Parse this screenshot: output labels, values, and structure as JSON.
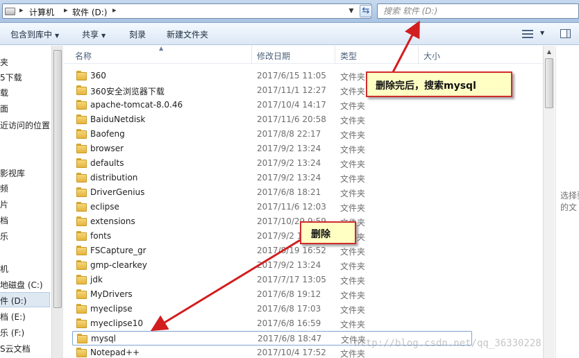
{
  "address_bar": {
    "crumbs": [
      "计算机",
      "软件 (D:)"
    ],
    "search_placeholder": "搜索 软件 (D:)"
  },
  "toolbar": {
    "include_library": "包含到库中",
    "share": "共享",
    "burn": "刻录",
    "new_folder": "新建文件夹"
  },
  "nav": {
    "items": [
      "夹",
      "5下载",
      "载",
      "面",
      "近访问的位置",
      "影视库",
      "频",
      "片",
      "档",
      "乐",
      "机",
      "地磁盘 (C:)",
      "件 (D:)",
      "档 (E:)",
      "乐 (F:)",
      "S云文档"
    ],
    "selected": "件 (D:)"
  },
  "list": {
    "columns": {
      "name": "名称",
      "date": "修改日期",
      "type": "类型",
      "size": "大小"
    },
    "rows": [
      {
        "name": "360",
        "date": "2017/6/15 11:05",
        "type": "文件夹"
      },
      {
        "name": "360安全浏览器下载",
        "date": "2017/11/1 12:27",
        "type": "文件夹"
      },
      {
        "name": "apache-tomcat-8.0.46",
        "date": "2017/10/4 14:17",
        "type": "文件夹"
      },
      {
        "name": "BaiduNetdisk",
        "date": "2017/11/6 20:58",
        "type": "文件夹"
      },
      {
        "name": "Baofeng",
        "date": "2017/8/8 22:17",
        "type": "文件夹"
      },
      {
        "name": "browser",
        "date": "2017/9/2 13:24",
        "type": "文件夹"
      },
      {
        "name": "defaults",
        "date": "2017/9/2 13:24",
        "type": "文件夹"
      },
      {
        "name": "distribution",
        "date": "2017/9/2 13:24",
        "type": "文件夹"
      },
      {
        "name": "DriverGenius",
        "date": "2017/6/8 18:21",
        "type": "文件夹"
      },
      {
        "name": "eclipse",
        "date": "2017/11/6 12:03",
        "type": "文件夹"
      },
      {
        "name": "extensions",
        "date": "2017/10/29 9:59",
        "type": "文件夹"
      },
      {
        "name": "fonts",
        "date": "2017/9/2 13:24",
        "type": "文件夹"
      },
      {
        "name": "FSCapture_gr",
        "date": "2017/8/19 16:52",
        "type": "文件夹"
      },
      {
        "name": "gmp-clearkey",
        "date": "2017/9/2 13:24",
        "type": "文件夹"
      },
      {
        "name": "jdk",
        "date": "2017/7/17 13:05",
        "type": "文件夹"
      },
      {
        "name": "MyDrivers",
        "date": "2017/6/8 19:12",
        "type": "文件夹"
      },
      {
        "name": "myeclipse",
        "date": "2017/6/8 17:03",
        "type": "文件夹"
      },
      {
        "name": "myeclipse10",
        "date": "2017/6/8 16:59",
        "type": "文件夹"
      },
      {
        "name": "mysql",
        "date": "2017/6/8 18:47",
        "type": "文件夹"
      },
      {
        "name": "Notepad++",
        "date": "2017/10/4 17:52",
        "type": "文件夹"
      }
    ],
    "selected_row": "mysql"
  },
  "preview": {
    "line1": "选择要",
    "line2": "的文"
  },
  "annotations": {
    "callout_search": "删除完后，搜索mysql",
    "callout_delete": "删除"
  },
  "watermark": "http://blog.csdn.net/qq_36330228",
  "colors": {
    "callout_border": "#d12b2b",
    "callout_fill": "#ffffc4",
    "arrow": "#d21e1e",
    "folder": "#e6b43c"
  }
}
